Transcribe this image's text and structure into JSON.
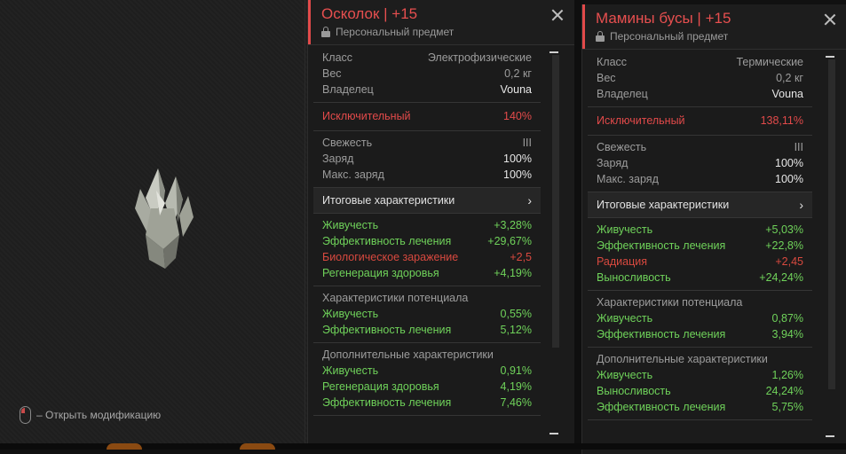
{
  "preview": {
    "hint_text": "– Открыть модификацию",
    "mouse_icon": "mouse-icon",
    "crystal_icon": "crystal-artifact-icon"
  },
  "colors": {
    "accent": "#e24a4a",
    "positive": "#6fd25a",
    "negative": "#d8493f",
    "panel_bg": "#1b1b1b"
  },
  "panels": [
    {
      "title": "Осколок | +15",
      "subtitle": "Персональный предмет",
      "info": [
        {
          "label": "Класс",
          "value": "Электрофизические"
        },
        {
          "label": "Вес",
          "value": "0,2 кг"
        },
        {
          "label": "Владелец",
          "value": "Vouna"
        }
      ],
      "rarity": {
        "label": "Исключительный",
        "value": "140%"
      },
      "state": [
        {
          "label": "Свежесть",
          "value": "III"
        },
        {
          "label": "Заряд",
          "value": "100%"
        },
        {
          "label": "Макс. заряд",
          "value": "100%"
        }
      ],
      "summary_label": "Итоговые характеристики",
      "totals": [
        {
          "label": "Живучесть",
          "value": "+3,28%",
          "tone": "green"
        },
        {
          "label": "Эффективность лечения",
          "value": "+29,67%",
          "tone": "green"
        },
        {
          "label": "Биологическое заражение",
          "value": "+2,5",
          "tone": "ltred"
        },
        {
          "label": "Регенерация здоровья",
          "value": "+4,19%",
          "tone": "green"
        }
      ],
      "potential_title": "Характеристики потенциала",
      "potential": [
        {
          "label": "Живучесть",
          "value": "0,55%"
        },
        {
          "label": "Эффективность лечения",
          "value": "5,12%"
        }
      ],
      "extra_title": "Дополнительные характеристики",
      "extra": [
        {
          "label": "Живучесть",
          "value": "0,91%"
        },
        {
          "label": "Регенерация здоровья",
          "value": "4,19%"
        },
        {
          "label": "Эффективность лечения",
          "value": "7,46%"
        }
      ]
    },
    {
      "title": "Мамины бусы | +15",
      "subtitle": "Персональный предмет",
      "info": [
        {
          "label": "Класс",
          "value": "Термические"
        },
        {
          "label": "Вес",
          "value": "0,2 кг"
        },
        {
          "label": "Владелец",
          "value": "Vouna"
        }
      ],
      "rarity": {
        "label": "Исключительный",
        "value": "138,11%"
      },
      "state": [
        {
          "label": "Свежесть",
          "value": "III"
        },
        {
          "label": "Заряд",
          "value": "100%"
        },
        {
          "label": "Макс. заряд",
          "value": "100%"
        }
      ],
      "summary_label": "Итоговые характеристики",
      "totals": [
        {
          "label": "Живучесть",
          "value": "+5,03%",
          "tone": "green"
        },
        {
          "label": "Эффективность лечения",
          "value": "+22,8%",
          "tone": "green"
        },
        {
          "label": "Радиация",
          "value": "+2,45",
          "tone": "ltred"
        },
        {
          "label": "Выносливость",
          "value": "+24,24%",
          "tone": "green"
        }
      ],
      "potential_title": "Характеристики потенциала",
      "potential": [
        {
          "label": "Живучесть",
          "value": "0,87%"
        },
        {
          "label": "Эффективность лечения",
          "value": "3,94%"
        }
      ],
      "extra_title": "Дополнительные характеристики",
      "extra": [
        {
          "label": "Живучесть",
          "value": "1,26%"
        },
        {
          "label": "Выносливость",
          "value": "24,24%"
        },
        {
          "label": "Эффективность лечения",
          "value": "5,75%"
        }
      ]
    }
  ]
}
